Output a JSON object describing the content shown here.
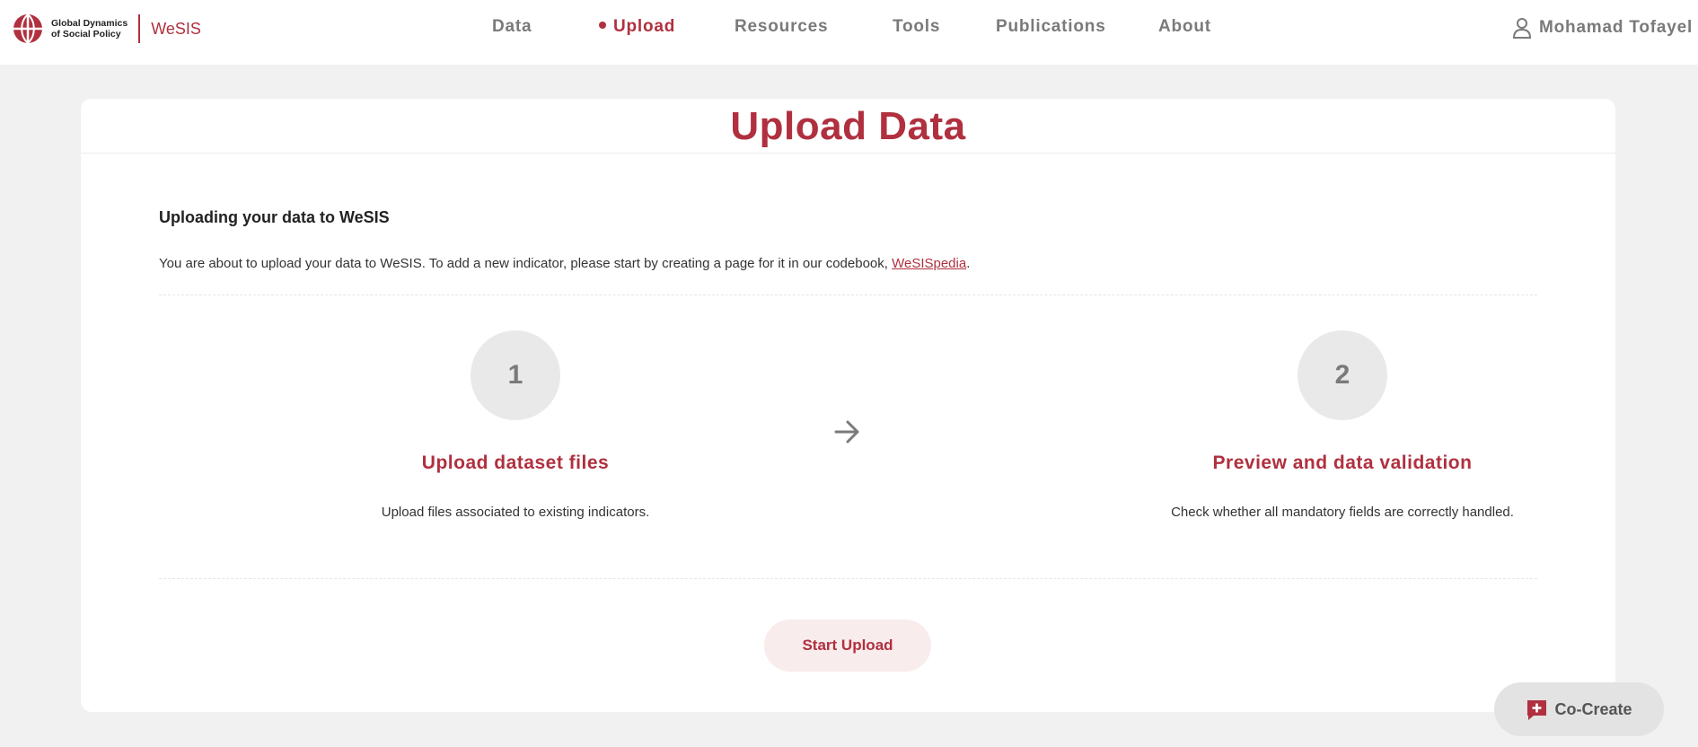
{
  "header": {
    "logo_text_line1": "Global Dynamics",
    "logo_text_line2": "of Social Policy",
    "brand": "WeSIS",
    "nav": [
      {
        "label": "Data",
        "active": false
      },
      {
        "label": "Upload",
        "active": true
      },
      {
        "label": "Resources",
        "active": false
      },
      {
        "label": "Tools",
        "active": false
      },
      {
        "label": "Publications",
        "active": false
      },
      {
        "label": "About",
        "active": false
      }
    ],
    "user_name": "Mohamad Tofayel",
    "user_icon": "user-icon"
  },
  "page": {
    "title": "Upload Data",
    "intro_heading": "Uploading your data to WeSIS",
    "intro_text_before": "You are about to upload your data to WeSIS. To add a new indicator, please start by creating a page for it in our codebook, ",
    "intro_link": "WeSISpedia",
    "intro_text_after": ".",
    "steps": [
      {
        "number": "1",
        "title": "Upload dataset files",
        "description": "Upload files associated to existing indicators."
      },
      {
        "number": "2",
        "title": "Preview and data validation",
        "description": "Check whether all mandatory fields are correctly handled."
      }
    ],
    "arrow_icon": "arrow-right-icon",
    "start_button": "Start Upload"
  },
  "cocreate": {
    "label": "Co-Create",
    "icon": "plus-chat-icon"
  },
  "colors": {
    "accent": "#b0303f",
    "nav_inactive": "#7a7a7a",
    "background": "#f1f1f1",
    "button_bg": "#f9ecec"
  }
}
